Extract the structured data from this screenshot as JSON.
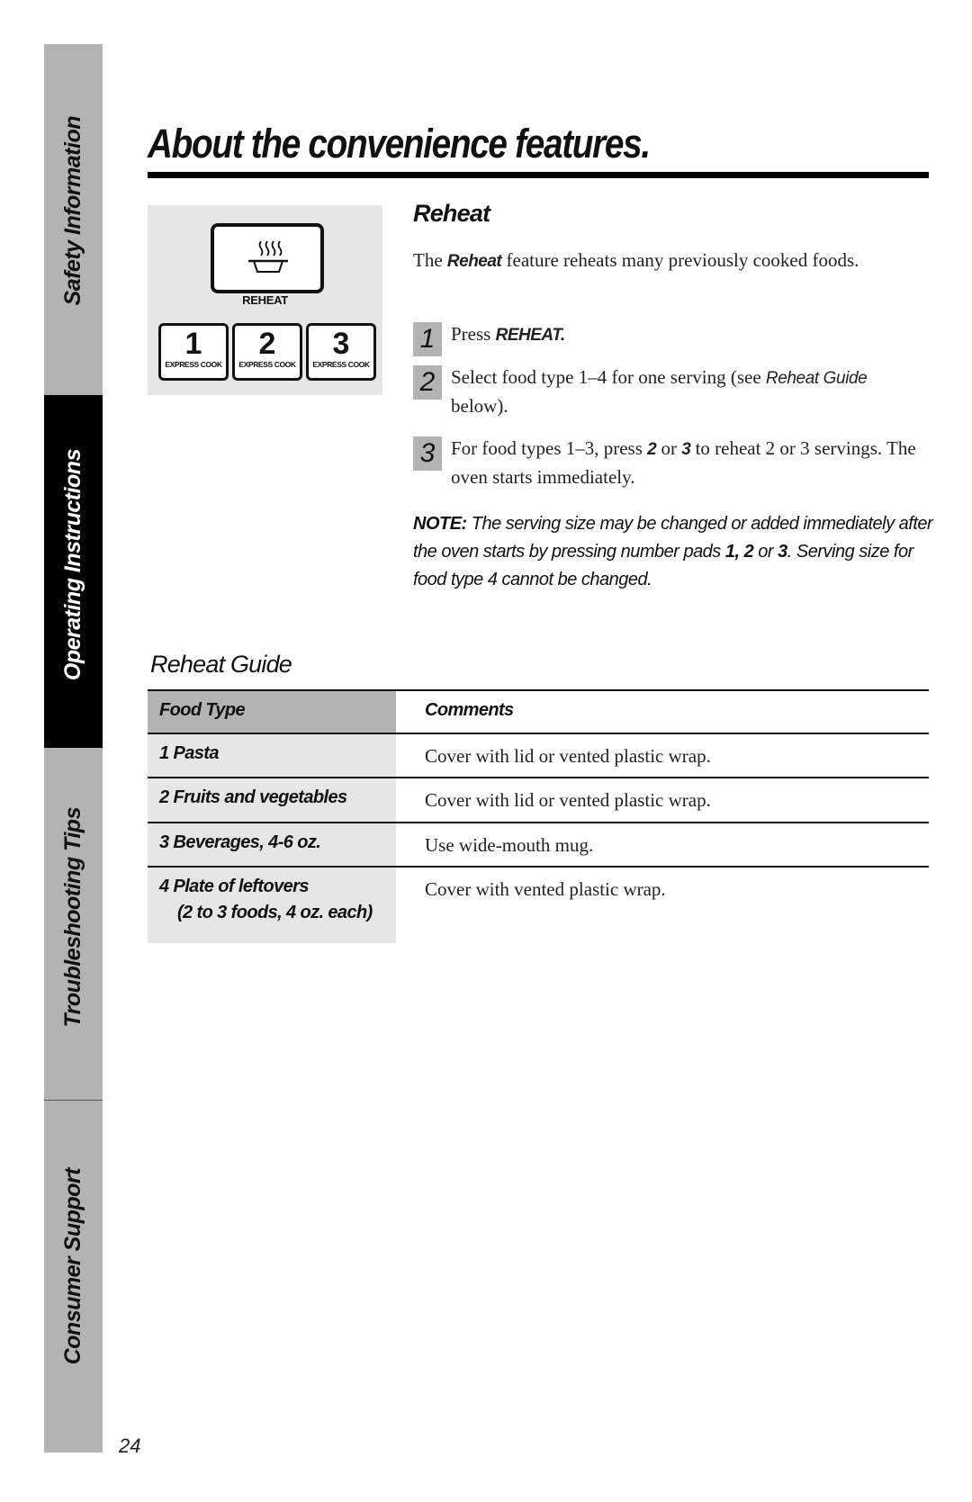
{
  "sidebar": {
    "tabs": [
      {
        "label": "Safety Information",
        "active": false
      },
      {
        "label": "Operating Instructions",
        "active": true
      },
      {
        "label": "Troubleshooting Tips",
        "active": false
      },
      {
        "label": "Consumer Support",
        "active": false
      }
    ]
  },
  "page": {
    "title": "About the convenience features.",
    "number": "24"
  },
  "panel": {
    "reheat_label": "REHEAT",
    "pads": [
      {
        "number": "1",
        "label": "EXPRESS COOK"
      },
      {
        "number": "2",
        "label": "EXPRESS COOK"
      },
      {
        "number": "3",
        "label": "EXPRESS COOK"
      }
    ]
  },
  "reheat": {
    "title": "Reheat",
    "intro_prefix": "The ",
    "intro_bold": "Reheat",
    "intro_suffix": "  feature reheats many previously cooked foods.",
    "steps": [
      {
        "num": "1",
        "text_prefix": "Press ",
        "text_bold": "REHEAT.",
        "text_suffix": ""
      },
      {
        "num": "2",
        "text_prefix": "Select food type 1–4 for one serving (see ",
        "text_italic": "Reheat Guide",
        "text_suffix": " below)."
      },
      {
        "num": "3",
        "text_prefix": "For food types 1–3, press ",
        "bold_a": "2",
        "mid": " or ",
        "bold_b": "3",
        "text_suffix": "  to reheat 2 or 3 servings. The oven starts immediately."
      }
    ],
    "note_label": "NOTE:",
    "note_text_1": " The serving size may be changed or added immediately after the oven starts by pressing number pads ",
    "note_bold_1": "1,",
    "note_space": " ",
    "note_bold_2": "2",
    "note_text_2": " or ",
    "note_bold_3": "3",
    "note_text_3": ". Serving size for food type 4 cannot be changed."
  },
  "guide": {
    "title": "Reheat Guide",
    "columns": [
      "Food Type",
      "Comments"
    ],
    "rows": [
      {
        "food": "1 Pasta",
        "sub": "",
        "comment": "Cover with lid or vented plastic wrap."
      },
      {
        "food": "2 Fruits and vegetables",
        "sub": "",
        "comment": "Cover with lid or vented plastic wrap."
      },
      {
        "food": "3 Beverages, 4-6 oz.",
        "sub": "",
        "comment": "Use wide-mouth mug."
      },
      {
        "food": "4 Plate of leftovers",
        "sub": "(2 to 3 foods, 4 oz. each)",
        "comment": "Cover with vented plastic wrap."
      }
    ]
  }
}
